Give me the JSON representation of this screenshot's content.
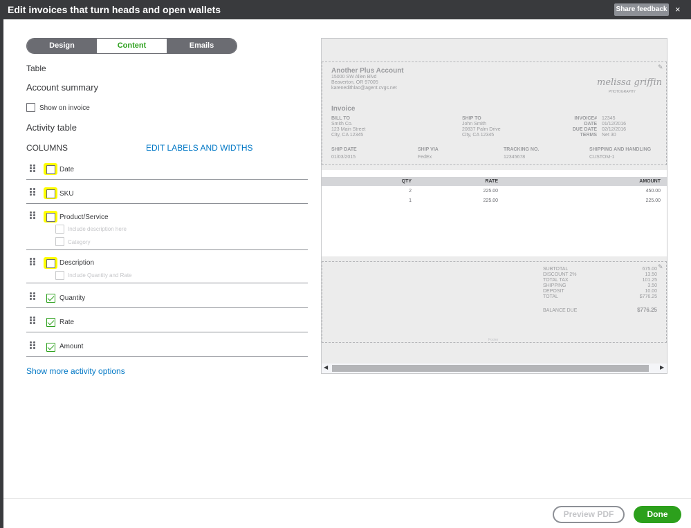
{
  "header": {
    "title": "Edit invoices that turn heads and open wallets",
    "share_feedback": "Share feedback",
    "close": "×"
  },
  "tabs": [
    "Design",
    "Content",
    "Emails"
  ],
  "left": {
    "section_table": "Table",
    "account_summary": "Account summary",
    "show_on_invoice": "Show on invoice",
    "activity_table": "Activity table",
    "columns_label": "COLUMNS",
    "edit_labels_link": "EDIT LABELS AND WIDTHS",
    "columns": [
      {
        "label": "Date",
        "checked": false
      },
      {
        "label": "SKU",
        "checked": false
      },
      {
        "label": "Product/Service",
        "checked": false
      },
      {
        "label": "Description",
        "checked": false
      },
      {
        "label": "Quantity",
        "checked": true
      },
      {
        "label": "Rate",
        "checked": true
      },
      {
        "label": "Amount",
        "checked": true
      }
    ],
    "product_sub": [
      "Include description here",
      "Category"
    ],
    "description_sub": "Include Quantity and Rate",
    "show_more": "Show more activity options"
  },
  "preview": {
    "company": "Another Plus Account",
    "address1": "15000 SW Allen Blvd",
    "address2": "Beaverton, OR 97005",
    "email": "karenedithlao@agent.cvgs.net",
    "logo_text": "melissa griffin",
    "logo_sub": "PHOTOGRAPHY",
    "invoice_heading": "Invoice",
    "bill_to_label": "BILL TO",
    "bill_to": [
      "Smith Co.",
      "123 Main Street",
      "City, CA 12345"
    ],
    "ship_to_label": "SHIP TO",
    "ship_to": [
      "John Smith",
      "20837 Palm Drive",
      "City, CA 12345"
    ],
    "meta_labels": [
      "INVOICE#",
      "DATE",
      "DUE DATE",
      "TERMS"
    ],
    "meta_values": [
      "12345",
      "01/12/2016",
      "02/12/2016",
      "Net 30"
    ],
    "ship_headers": [
      "SHIP DATE",
      "SHIP VIA",
      "TRACKING NO.",
      "SHIPPING AND HANDLING"
    ],
    "ship_values": [
      "01/03/2015",
      "FedEx",
      "12345678",
      "CUSTOM-1"
    ],
    "table_headers": [
      "QTY",
      "RATE",
      "AMOUNT"
    ],
    "rows": [
      {
        "qty": "2",
        "rate": "225.00",
        "amount": "450.00"
      },
      {
        "qty": "1",
        "rate": "225.00",
        "amount": "225.00"
      }
    ],
    "totals_labels": [
      "SUBTOTAL",
      "DISCOUNT 2%",
      "TOTAL TAX",
      "SHIPPING",
      "DEPOSIT",
      "TOTAL"
    ],
    "totals_values": [
      "675.00",
      "13.50",
      "101.25",
      "3.50",
      "10.00",
      "$776.25"
    ],
    "balance_label": "BALANCE DUE",
    "balance_value": "$776.25",
    "footer_text": "Footer"
  },
  "footer": {
    "preview_pdf": "Preview PDF",
    "done": "Done"
  },
  "colors": {
    "accent": "#2ca01c",
    "link": "#0077c5",
    "highlight": "#ffff00",
    "header_bg": "#393a3d"
  }
}
